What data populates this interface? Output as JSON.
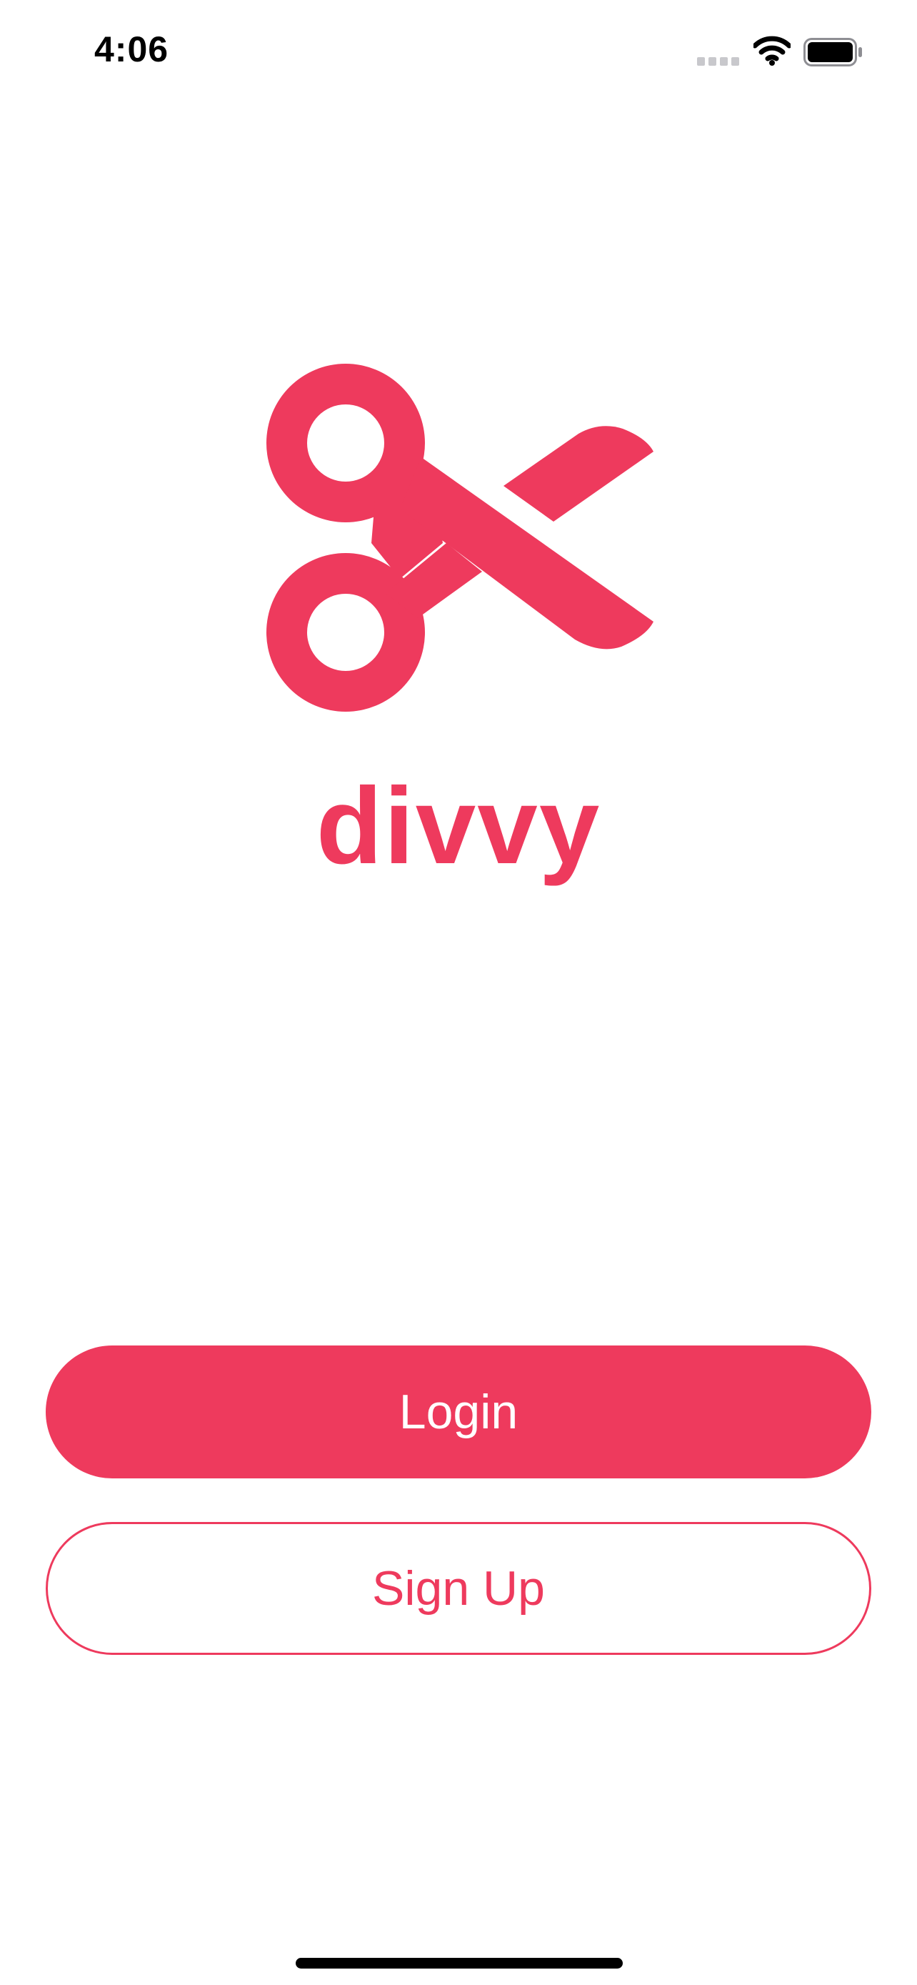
{
  "status_bar": {
    "time": "4:06",
    "signal_icon": "cellular-signal-icon",
    "wifi_icon": "wifi-icon",
    "battery_icon": "battery-icon"
  },
  "brand": {
    "logo_icon": "scissors-icon",
    "name": "divvy",
    "accent_color": "#ee3a5d"
  },
  "actions": {
    "login_label": "Login",
    "signup_label": "Sign Up"
  }
}
